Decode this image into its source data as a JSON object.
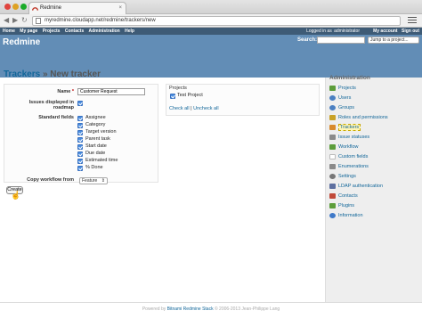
{
  "browser": {
    "tab_title": "Redmine",
    "tab_close": "×",
    "url": "myredmine.cloudapp.net/redmine/trackers/new",
    "back": "◀",
    "forward": "▶",
    "reload": "↻"
  },
  "top_menu": {
    "items": [
      "Home",
      "My page",
      "Projects",
      "Contacts",
      "Administration",
      "Help"
    ],
    "logged_in_prefix": "Logged in as",
    "logged_in_user": "administrator",
    "links": [
      "My account",
      "Sign out"
    ]
  },
  "header": {
    "title": "Redmine",
    "search_label": "Search:",
    "jump_placeholder": "Jump to a project..."
  },
  "page": {
    "breadcrumb_link": "Trackers",
    "title_separator": "»",
    "title": "New tracker"
  },
  "form": {
    "name_label": "Name",
    "required_mark": "*",
    "name_value": "Customer Request",
    "roadmap_label_line1": "Issues displayed in",
    "roadmap_label_line2": "roadmap",
    "standard_fields_label": "Standard fields",
    "standard_fields": [
      "Assignee",
      "Category",
      "Target version",
      "Parent task",
      "Start date",
      "Due date",
      "Estimated time",
      "% Done"
    ],
    "copy_workflow_label": "Copy workflow from",
    "copy_workflow_value": "Feature",
    "create_button": "Create"
  },
  "projects": {
    "legend": "Projects",
    "items": [
      "Test Project"
    ],
    "check_all": "Check all",
    "separator": "|",
    "uncheck_all": "Uncheck all"
  },
  "sidebar": {
    "title": "Administration",
    "items": [
      {
        "label": "Projects",
        "icon": "projects-icon",
        "color": "#5c9d3a"
      },
      {
        "label": "Users",
        "icon": "users-icon",
        "color": "#4a7fc1"
      },
      {
        "label": "Groups",
        "icon": "groups-icon",
        "color": "#4a7fc1"
      },
      {
        "label": "Roles and permissions",
        "icon": "key-icon",
        "color": "#c9a227"
      },
      {
        "label": "Trackers",
        "icon": "tracker-icon",
        "color": "#d88a2c"
      },
      {
        "label": "Issue statuses",
        "icon": "status-icon",
        "color": "#8a8a8a"
      },
      {
        "label": "Workflow",
        "icon": "workflow-icon",
        "color": "#5c9d3a"
      },
      {
        "label": "Custom fields",
        "icon": "custom-field-icon",
        "color": "#dddddd"
      },
      {
        "label": "Enumerations",
        "icon": "list-icon",
        "color": "#8a8a8a"
      },
      {
        "label": "Settings",
        "icon": "settings-icon",
        "color": "#777777"
      },
      {
        "label": "LDAP authentication",
        "icon": "server-icon",
        "color": "#5d6fa0"
      },
      {
        "label": "Contacts",
        "icon": "contacts-icon",
        "color": "#c04a3a"
      },
      {
        "label": "Plugins",
        "icon": "plugin-icon",
        "color": "#5c9d3a"
      },
      {
        "label": "Information",
        "icon": "info-icon",
        "color": "#3f79c8"
      }
    ],
    "selected": "Trackers"
  },
  "footer": {
    "prefix": "Powered by",
    "link": "Bitnami Redmine Stack",
    "suffix": "© 2006-2013 Jean-Philippe Lang"
  }
}
